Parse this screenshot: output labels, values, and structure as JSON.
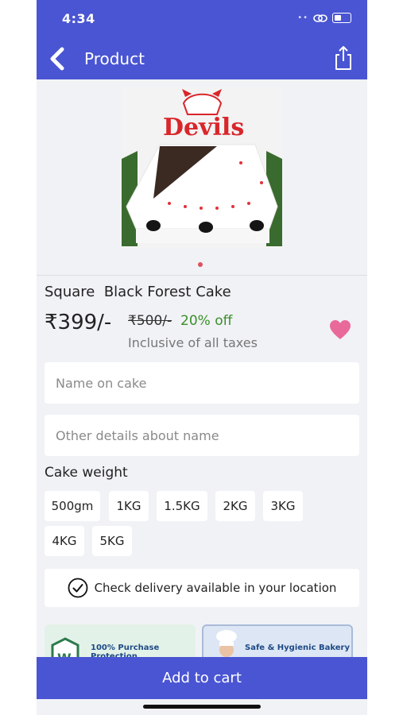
{
  "status": {
    "time": "4:34"
  },
  "header": {
    "title": "Product"
  },
  "product": {
    "name": "Square  Black Forest Cake",
    "price": "₹399/-",
    "old_price": "₹500/-",
    "discount": "20% off",
    "tax_note": "Inclusive of all taxes",
    "topper_text": "Devils"
  },
  "inputs": {
    "name_on_cake_placeholder": "Name on cake",
    "other_details_placeholder": "Other details about name"
  },
  "weight": {
    "title": "Cake weight",
    "options": [
      "500gm",
      "1KG",
      "1.5KG",
      "2KG",
      "3KG",
      "4KG",
      "5KG"
    ]
  },
  "delivery": {
    "label": "Check delivery available in your location"
  },
  "promos": {
    "protection": "100% Purchase Protection",
    "bakery": "Safe & Hygienic Bakery"
  },
  "cart": {
    "label": "Add to cart"
  },
  "colors": {
    "accent": "#4a55d3",
    "heart": "#e96a9a",
    "discount": "#3a8f2a"
  }
}
